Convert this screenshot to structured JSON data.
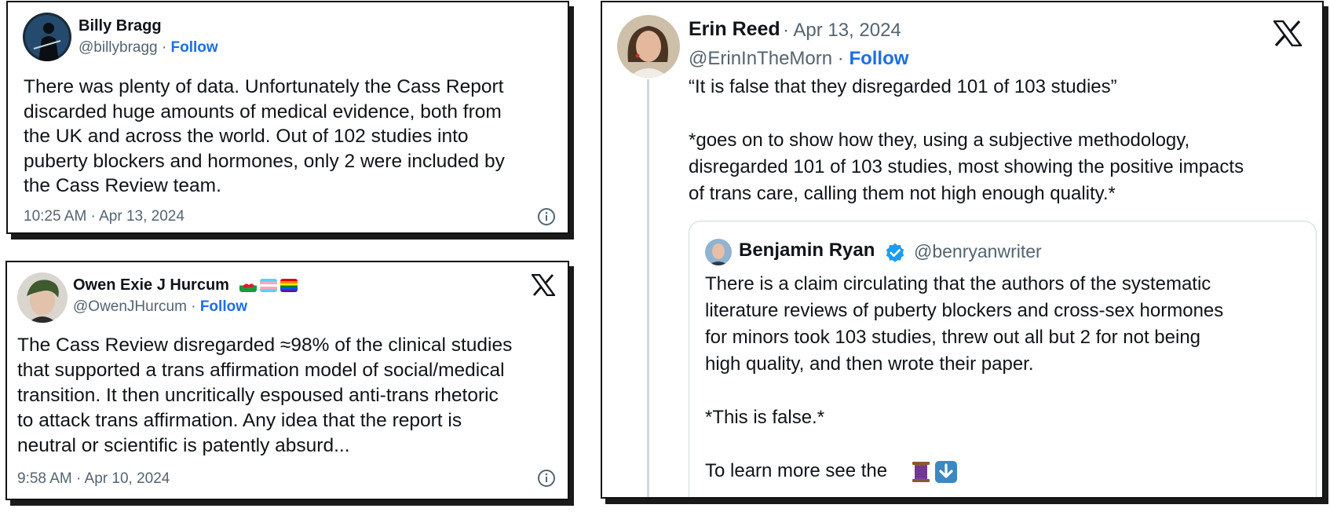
{
  "tweets": {
    "bragg": {
      "name": "Billy Bragg",
      "handle": "@billybragg",
      "separator": "·",
      "follow": "Follow",
      "text": "There was plenty of data. Unfortunately the Cass Report\ndiscarded huge amounts of medical evidence, both from\nthe UK and across the world. Out of 102 studies into\npuberty blockers and hormones, only 2 were included by\nthe Cass Review team.",
      "timestamp": "10:25 AM · Apr 13, 2024",
      "icons": [
        "avatar",
        "info-icon"
      ]
    },
    "hurcum": {
      "name": "Owen Exie J Hurcum",
      "flags": [
        "wales-flag",
        "transgender-flag",
        "rainbow-flag"
      ],
      "handle": "@OwenJHurcum",
      "separator": "·",
      "follow": "Follow",
      "text": "The Cass Review disregarded ≈98% of the clinical studies\nthat supported a trans affirmation model of social/medical\ntransition. It then uncritically espoused anti-trans rhetoric\nto attack trans affirmation. Any idea that the report is\nneutral or scientific is patently absurd...",
      "timestamp": "9:58 AM · Apr 10, 2024",
      "icons": [
        "x-logo-icon",
        "info-icon"
      ]
    },
    "reed": {
      "name": "Erin Reed",
      "date": "· Apr 13, 2024",
      "handle": "@ErinInTheMorn",
      "separator": "·",
      "follow": "Follow",
      "text": "“It is false that they disregarded 101 of 103 studies”\n\n*goes on to show how they, using a subjective methodology,\ndisregarded 101 of 103 studies, most showing the positive impacts\nof trans care, calling them not high enough quality.*",
      "quote": {
        "name": "Benjamin Ryan",
        "handle": "@benryanwriter",
        "text": "There is a claim circulating that the authors of the systematic\nliterature reviews of puberty blockers and cross-sex hormones\nfor minors took 103 studies, threw out all but 2 for not being\nhigh quality, and then wrote their paper.\n\n*This is false.*\n\nTo learn more see the",
        "emojis": [
          "thread-spool-icon",
          "down-arrow-icon"
        ]
      }
    }
  },
  "colors": {
    "follow": "#1d6fe0",
    "muted": "#536471",
    "verified": "#1d9bf0",
    "border": "#cfd9de"
  }
}
